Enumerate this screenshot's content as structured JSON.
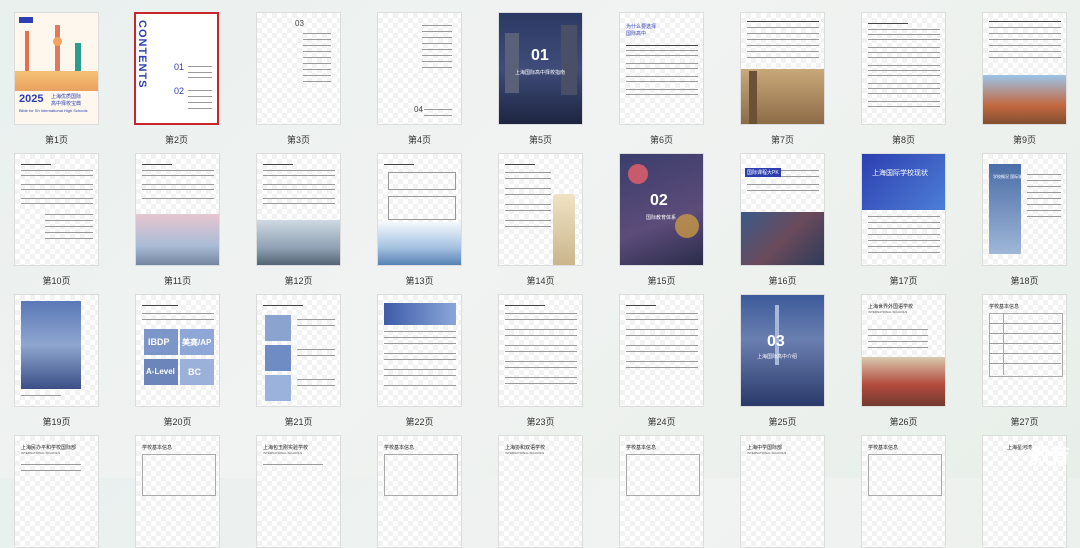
{
  "pages": [
    {
      "label": "第1页",
      "cover": {
        "year": "2025",
        "title": "上海优质国际",
        "title2": "高中择校宝典",
        "subtitle": "Bible for Sh International High Schools"
      }
    },
    {
      "label": "第2页",
      "contents": "CONTENTS",
      "n1": "01",
      "n2": "02"
    },
    {
      "label": "第3页",
      "n": "03"
    },
    {
      "label": "第4页",
      "n": "04"
    },
    {
      "label": "第5页",
      "num": "01",
      "caption": "上海国际高中择校指南"
    },
    {
      "label": "第6页",
      "heading": "为什么要选择",
      "heading2": "国际高中"
    },
    {
      "label": "第7页"
    },
    {
      "label": "第8页"
    },
    {
      "label": "第9页"
    },
    {
      "label": "第10页"
    },
    {
      "label": "第11页"
    },
    {
      "label": "第12页"
    },
    {
      "label": "第13页"
    },
    {
      "label": "第14页"
    },
    {
      "label": "第15页",
      "num": "02",
      "caption": "国际教育体系"
    },
    {
      "label": "第16页",
      "box": "国际课程大PK"
    },
    {
      "label": "第17页",
      "title": "上海国际学校现状"
    },
    {
      "label": "第18页",
      "title": "学校概况 国际课程"
    },
    {
      "label": "第19页"
    },
    {
      "label": "第20页",
      "t1": "IBDP",
      "t2": "美高/AP",
      "t3": "A-Level",
      "t4": "BC"
    },
    {
      "label": "第21页"
    },
    {
      "label": "第22页"
    },
    {
      "label": "第23页"
    },
    {
      "label": "第24页"
    },
    {
      "label": "第25页",
      "num": "03",
      "caption": "上海国际高中介绍"
    },
    {
      "label": "第26页",
      "title": "上海世界外国语学校",
      "sub": "INTERNATIONAL SCHOOLS"
    },
    {
      "label": "第27页",
      "title": "学校基本信息"
    },
    {
      "label": "",
      "title": "上海民办平和学校国际部",
      "sub": "INTERNATIONAL SCHOOLS"
    },
    {
      "label": "",
      "title": "学校基本信息"
    },
    {
      "label": "",
      "title": "上海包玉刚实验学校",
      "sub": "INTERNATIONAL SCHOOLS"
    },
    {
      "label": "",
      "title": "学校基本信息"
    },
    {
      "label": "",
      "title": "上海协和双语学校",
      "sub": "INTERNATIONAL SCHOOLS"
    },
    {
      "label": "",
      "title": "学校基本信息"
    },
    {
      "label": "",
      "title": "上海中学国际部",
      "sub": "INTERNATIONAL SCHOOLS"
    },
    {
      "label": "",
      "title": "学校基本信息"
    },
    {
      "label": "",
      "title": "上海星河湾"
    }
  ],
  "watermark": "教育",
  "colors": {
    "brand": "#2d3fb0",
    "selected": "#c9252c",
    "label": "#333333"
  }
}
